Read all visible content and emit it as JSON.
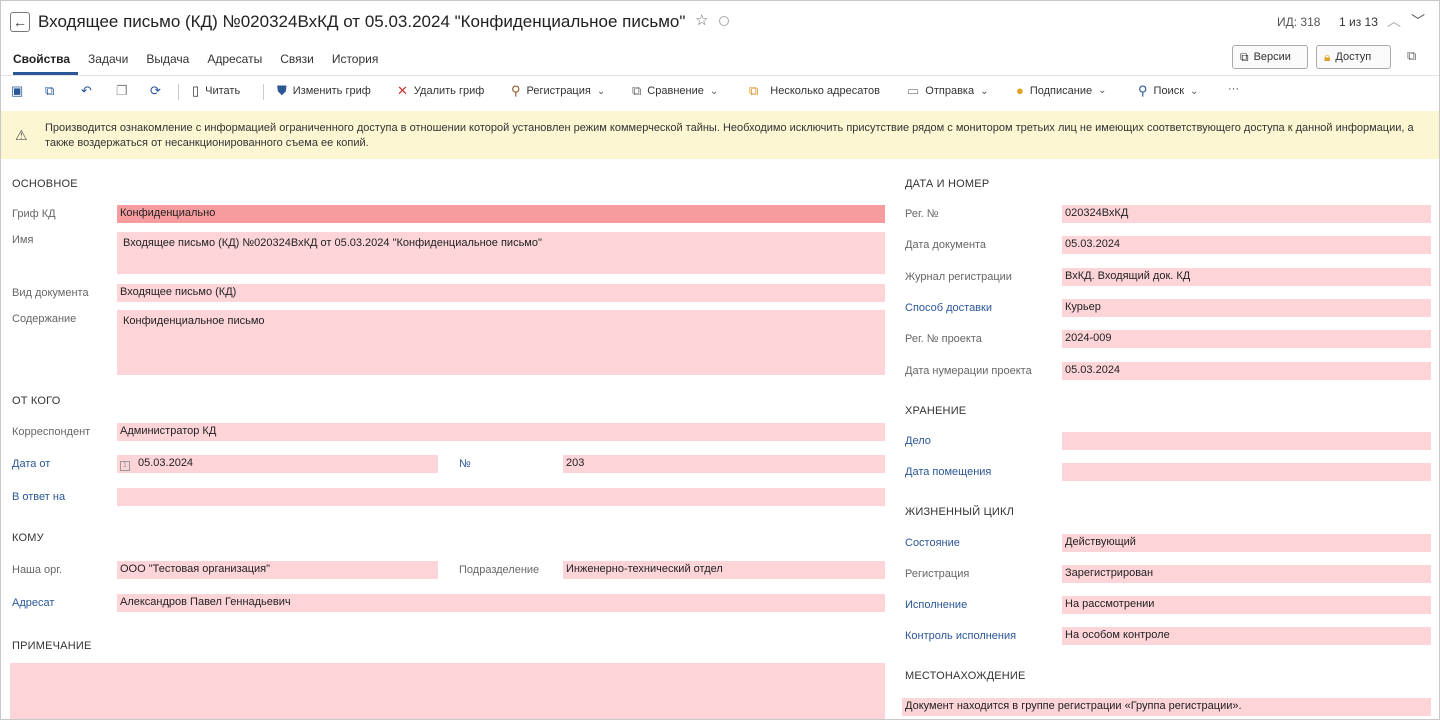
{
  "window": {
    "title": "Входящее письмо (КД) №020324ВхКД от 05.03.2024 \"Конфиденциальное письмо\"",
    "id_label": "ИД: 318",
    "pager": "1 из 13"
  },
  "tabs": [
    {
      "label": "Свойства",
      "active": true
    },
    {
      "label": "Задачи"
    },
    {
      "label": "Выдача"
    },
    {
      "label": "Адресаты"
    },
    {
      "label": "Связи"
    },
    {
      "label": "История"
    }
  ],
  "top_buttons": {
    "versions": "Версии",
    "access": "Доступ"
  },
  "toolbar": {
    "read": "Читать",
    "change_grif": "Изменить гриф",
    "delete_grif": "Удалить гриф",
    "registration": "Регистрация",
    "compare": "Сравнение",
    "multi_addressees": "Несколько адресатов",
    "send": "Отправка",
    "sign": "Подписание",
    "search": "Поиск",
    "more": "···"
  },
  "warning": "Производится ознакомление с информацией ограниченного доступа в отношении которой установлен режим коммерческой тайны. Необходимо исключить присутствие рядом с монитором третьих лиц не имеющих соответствующего доступа к данной информации, а также воздержаться от несанкционированного съема ее копий.",
  "left": {
    "main": {
      "header": "ОСНОВНОЕ",
      "grif_label": "Гриф КД",
      "grif_value": "Конфиденциально",
      "name_label": "Имя",
      "name_value": "Входящее письмо (КД) №020324ВхКД от 05.03.2024 \"Конфиденциальное письмо\"",
      "doctype_label": "Вид документа",
      "doctype_value": "Входящее письмо (КД)",
      "content_label": "Содержание",
      "content_value": "Конфиденциальное письмо"
    },
    "from": {
      "header": "ОТ КОГО",
      "correspondent_label": "Корреспондент",
      "correspondent_value": "Администратор КД",
      "date_label": "Дата от",
      "date_value": "05.03.2024",
      "number_label": "№",
      "number_value": "203",
      "reply_label": "В ответ на",
      "reply_value": ""
    },
    "to": {
      "header": "КОМУ",
      "org_label": "Наша орг.",
      "org_value": "ООО \"Тестовая организация\"",
      "dept_label": "Подразделение",
      "dept_value": "Инженерно-технический отдел",
      "addressee_label": "Адресат",
      "addressee_value": "Александров Павел Геннадьевич"
    },
    "note": {
      "header": "ПРИМЕЧАНИЕ",
      "value": ""
    }
  },
  "right": {
    "date_number": {
      "header": "ДАТА И НОМЕР",
      "reg_no_label": "Рег. №",
      "reg_no_value": "020324ВхКД",
      "doc_date_label": "Дата документа",
      "doc_date_value": "05.03.2024",
      "journal_label": "Журнал регистрации",
      "journal_value": "ВхКД. Входящий док. КД",
      "delivery_label": "Способ доставки",
      "delivery_value": "Курьер",
      "project_no_label": "Рег. № проекта",
      "project_no_value": "2024-009",
      "project_date_label": "Дата нумерации проекта",
      "project_date_value": "05.03.2024"
    },
    "storage": {
      "header": "ХРАНЕНИЕ",
      "case_label": "Дело",
      "case_value": "",
      "placed_label": "Дата помещения",
      "placed_value": ""
    },
    "lifecycle": {
      "header": "ЖИЗНЕННЫЙ ЦИКЛ",
      "state_label": "Состояние",
      "state_value": "Действующий",
      "registration_label": "Регистрация",
      "registration_value": "Зарегистрирован",
      "execution_label": "Исполнение",
      "execution_value": "На рассмотрении",
      "control_label": "Контроль исполнения",
      "control_value": "На особом контроле"
    },
    "location": {
      "header": "МЕСТОНАХОЖДЕНИЕ",
      "value": "Документ находится в группе регистрации «Группа регистрации»."
    }
  },
  "colors": {
    "field_bg": "#fdd5d9",
    "grif_bg": "#f79c9e",
    "warning_bg": "#fdf6d3",
    "accent": "#2b5797"
  }
}
